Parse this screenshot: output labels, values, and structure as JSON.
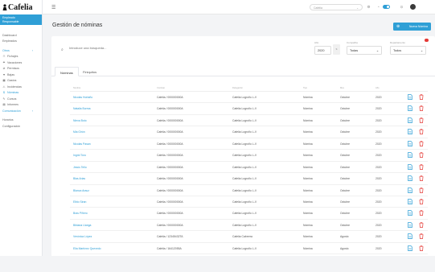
{
  "app": {
    "logo": "Cafelia"
  },
  "sidebar": {
    "company_name": "Empleado",
    "company_sub": "Responsable",
    "items": [
      {
        "label": "Dashboard",
        "type": "plain"
      },
      {
        "label": "Empleados",
        "type": "plain"
      },
      {
        "label": "Otros",
        "type": "group"
      },
      {
        "label": "Fichajes",
        "type": "sub",
        "icon": "⏱"
      },
      {
        "label": "Vacaciones",
        "type": "sub",
        "icon": "☂"
      },
      {
        "label": "Permisos",
        "type": "sub",
        "icon": "⊘"
      },
      {
        "label": "Bajas",
        "type": "sub",
        "icon": "♥"
      },
      {
        "label": "Gastos",
        "type": "sub",
        "icon": "▦"
      },
      {
        "label": "Incidencias",
        "type": "sub",
        "icon": "⚠"
      },
      {
        "label": "Nóminas",
        "type": "active",
        "icon": "$"
      },
      {
        "label": "Cursos",
        "type": "sub",
        "icon": "✎"
      },
      {
        "label": "Informes",
        "type": "sub",
        "icon": "▤"
      },
      {
        "label": "Comunicación",
        "type": "group"
      },
      {
        "label": "Horarios",
        "type": "plain"
      },
      {
        "label": "Configuración",
        "type": "plain"
      }
    ]
  },
  "topbar": {
    "company_placeholder": "Cafelia",
    "chevron": "⌄"
  },
  "header": {
    "title": "Gestión de nóminas",
    "new_button": "Nueva Nómina"
  },
  "filters": {
    "search_placeholder": "Introduce una búsqueda...",
    "year_label": "Año",
    "year_value": "2020",
    "company_label": "Compañía",
    "company_value": "Todas",
    "department_label": "Departamento",
    "department_value": "Todos"
  },
  "tabs": [
    {
      "label": "Nóminas",
      "active": true
    },
    {
      "label": "Finiquitos",
      "active": false
    }
  ],
  "table": {
    "headers": [
      "Nombre",
      "Contrato",
      "Delegación",
      "Tipo",
      "Mes",
      "Año"
    ],
    "rows": [
      [
        "Nicolas Hortaño",
        "Cafelia / 000000000A",
        "Cafelia Logroño L-V",
        "Nómina",
        "Octubre",
        "2020"
      ],
      [
        "Natalia Burma",
        "Cafelia / 000000000A",
        "Cafelia Logroño L-V",
        "Nómina",
        "Octubre",
        "2020"
      ],
      [
        "Nieva Boto",
        "Cafelia / 000000000A",
        "Cafelia Logroño L-V",
        "Nómina",
        "Octubre",
        "2020"
      ],
      [
        "Mia Girón",
        "Cafelia / 000000000A",
        "Cafelia Logroño L-V",
        "Nómina",
        "Octubre",
        "2020"
      ],
      [
        "Nicolas Pasan",
        "Cafelia / 000000000A",
        "Cafelia Logroño L-V",
        "Nómina",
        "Octubre",
        "2020"
      ],
      [
        "Ingrid Toro",
        "Cafelia / 000000000A",
        "Cafelia Logroño L-V",
        "Nómina",
        "Octubre",
        "2020"
      ],
      [
        "Jesús Tello",
        "Cafelia / 000000000A",
        "Cafelia Logroño L-V",
        "Nómina",
        "Octubre",
        "2020"
      ],
      [
        "Blas Arias",
        "Cafelia / 000000000A",
        "Cafelia Logroño L-V",
        "Nómina",
        "Octubre",
        "2020"
      ],
      [
        "Blanca Arauz",
        "Cafelia / 000000000A",
        "Cafelia Logroño L-V",
        "Nómina",
        "Octubre",
        "2020"
      ],
      [
        "Elbio Siran",
        "Cafelia / 000000000A",
        "Cafelia Logroño L-V",
        "Nómina",
        "Octubre",
        "2020"
      ],
      [
        "Bras Piñero",
        "Cafelia / 000000000A",
        "Cafelia Logroño L-V",
        "Nómina",
        "Octubre",
        "2020"
      ],
      [
        "Bibiana Llanga",
        "Cafelia / 000000000A",
        "Cafelia Logroño L-V",
        "Nómina",
        "Octubre",
        "2020"
      ],
      [
        "Verónica López",
        "Cafelia / 12345432TA",
        "Cafelia Cabrerra",
        "Nómina",
        "Agosto",
        "2020"
      ],
      [
        "Elia Martínez Quevedo",
        "Cafelia / 16412055A",
        "Cafelia Logroño L-V",
        "Nómina",
        "Agosto",
        "2020"
      ]
    ]
  }
}
